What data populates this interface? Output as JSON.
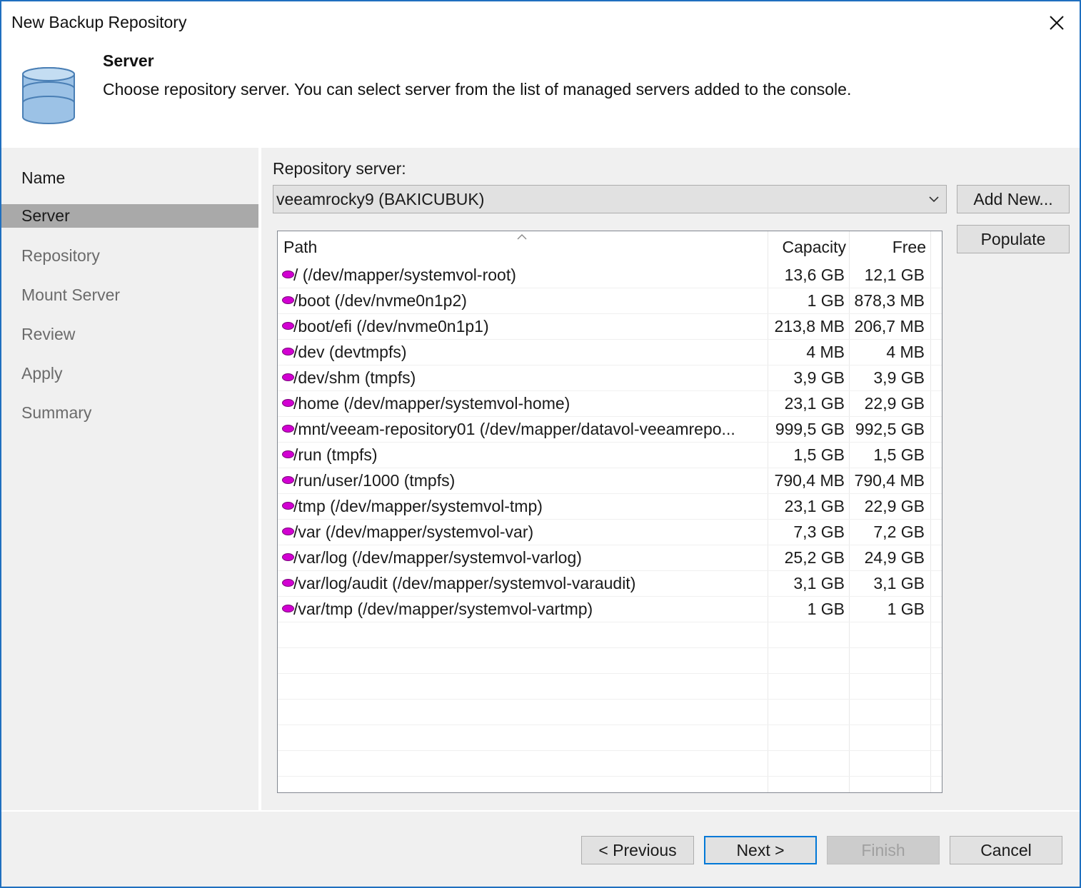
{
  "window": {
    "title": "New Backup Repository",
    "accent_color": "#1f6fbf"
  },
  "header": {
    "step_title": "Server",
    "step_description": "Choose repository server. You can select server from the list of managed servers added to the console.",
    "icon": "database-icon"
  },
  "sidebar": {
    "items": [
      {
        "label": "Name",
        "state": "completed"
      },
      {
        "label": "Server",
        "state": "active"
      },
      {
        "label": "Repository",
        "state": "pending"
      },
      {
        "label": "Mount Server",
        "state": "pending"
      },
      {
        "label": "Review",
        "state": "pending"
      },
      {
        "label": "Apply",
        "state": "pending"
      },
      {
        "label": "Summary",
        "state": "pending"
      }
    ]
  },
  "main": {
    "repository_server_label": "Repository server:",
    "selected_server": "veeamrocky9 (BAKICUBUK)",
    "add_new_label": "Add New...",
    "populate_label": "Populate",
    "table": {
      "columns": [
        "Path",
        "Capacity",
        "Free"
      ],
      "sorted_column": "Path",
      "volume_icon_color": "#d200d2",
      "rows": [
        {
          "path": "/ (/dev/mapper/systemvol-root)",
          "capacity": "13,6 GB",
          "free": "12,1 GB"
        },
        {
          "path": "/boot (/dev/nvme0n1p2)",
          "capacity": "1 GB",
          "free": "878,3 MB"
        },
        {
          "path": "/boot/efi (/dev/nvme0n1p1)",
          "capacity": "213,8 MB",
          "free": "206,7 MB"
        },
        {
          "path": "/dev (devtmpfs)",
          "capacity": "4 MB",
          "free": "4 MB"
        },
        {
          "path": "/dev/shm (tmpfs)",
          "capacity": "3,9 GB",
          "free": "3,9 GB"
        },
        {
          "path": "/home (/dev/mapper/systemvol-home)",
          "capacity": "23,1 GB",
          "free": "22,9 GB"
        },
        {
          "path": "/mnt/veeam-repository01 (/dev/mapper/datavol-veeamrepo...",
          "capacity": "999,5 GB",
          "free": "992,5 GB"
        },
        {
          "path": "/run (tmpfs)",
          "capacity": "1,5 GB",
          "free": "1,5 GB"
        },
        {
          "path": "/run/user/1000 (tmpfs)",
          "capacity": "790,4 MB",
          "free": "790,4 MB"
        },
        {
          "path": "/tmp (/dev/mapper/systemvol-tmp)",
          "capacity": "23,1 GB",
          "free": "22,9 GB"
        },
        {
          "path": "/var (/dev/mapper/systemvol-var)",
          "capacity": "7,3 GB",
          "free": "7,2 GB"
        },
        {
          "path": "/var/log (/dev/mapper/systemvol-varlog)",
          "capacity": "25,2 GB",
          "free": "24,9 GB"
        },
        {
          "path": "/var/log/audit (/dev/mapper/systemvol-varaudit)",
          "capacity": "3,1 GB",
          "free": "3,1 GB"
        },
        {
          "path": "/var/tmp (/dev/mapper/systemvol-vartmp)",
          "capacity": "1 GB",
          "free": "1 GB"
        }
      ]
    }
  },
  "footer": {
    "previous_label": "< Previous",
    "next_label": "Next >",
    "finish_label": "Finish",
    "finish_enabled": false,
    "cancel_label": "Cancel"
  }
}
